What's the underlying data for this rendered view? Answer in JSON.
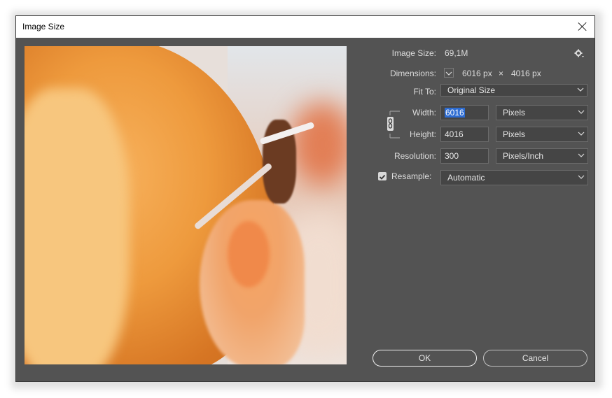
{
  "window": {
    "title": "Image Size"
  },
  "info": {
    "image_size_label": "Image Size:",
    "image_size_value": "69,1M",
    "dimensions_label": "Dimensions:",
    "dim_width": "6016 px",
    "dim_times": "×",
    "dim_height": "4016 px"
  },
  "fit_to": {
    "label": "Fit To:",
    "value": "Original Size"
  },
  "width": {
    "label": "Width:",
    "value": "6016",
    "unit": "Pixels"
  },
  "height": {
    "label": "Height:",
    "value": "4016",
    "unit": "Pixels"
  },
  "resolution": {
    "label": "Resolution:",
    "value": "300",
    "unit": "Pixels/Inch"
  },
  "resample": {
    "label": "Resample:",
    "checked": true,
    "value": "Automatic"
  },
  "buttons": {
    "ok": "OK",
    "cancel": "Cancel"
  },
  "icons": [
    "close-icon",
    "gear-icon",
    "chevron-down-icon",
    "link-chain-icon",
    "checkbox-checked-icon"
  ]
}
